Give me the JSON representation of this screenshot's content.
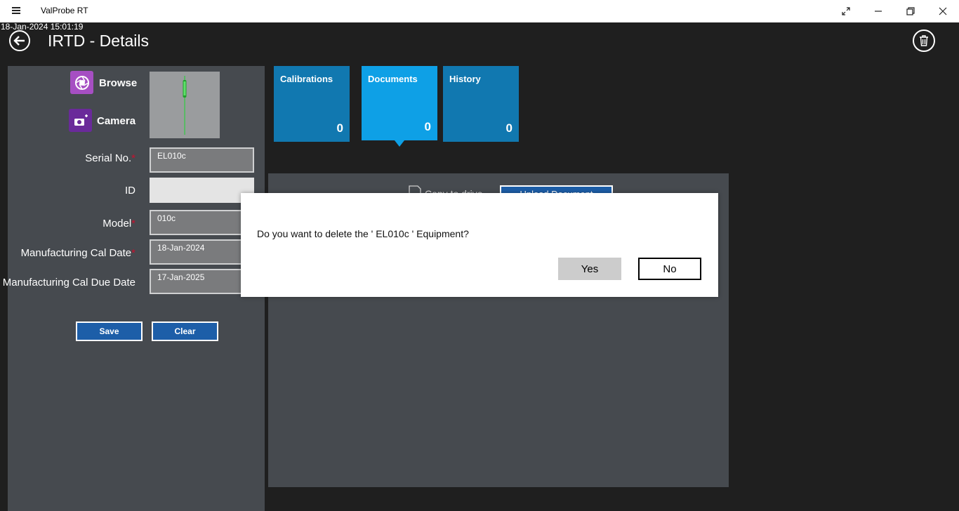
{
  "window": {
    "title": "ValProbe RT",
    "controls": [
      "expand-icon",
      "minimize-icon",
      "restore-icon",
      "close-icon"
    ]
  },
  "header": {
    "timestamp": "18-Jan-2024 15:01:19",
    "title": "IRTD - Details"
  },
  "image_source": {
    "browse_label": "Browse",
    "camera_label": "Camera"
  },
  "form": {
    "serial_label": "Serial No.",
    "serial_value": "EL010c",
    "id_label": "ID",
    "id_value": "",
    "model_label": "Model",
    "model_value": "010c",
    "mfg_cal_date_label": "Manufacturing Cal Date",
    "mfg_cal_date_value": "18-Jan-2024",
    "mfg_cal_due_label": "Manufacturing Cal Due Date",
    "mfg_cal_due_value": "17-Jan-2025",
    "required_mark": "*",
    "save_label": "Save",
    "clear_label": "Clear"
  },
  "tiles": [
    {
      "label": "Calibrations",
      "count": "0",
      "color": "#1178b0"
    },
    {
      "label": "Documents",
      "count": "0",
      "color": "#0ea0e6",
      "selected": true
    },
    {
      "label": "History",
      "count": "0",
      "color": "#1178b0"
    }
  ],
  "documents": {
    "copy_to_drive": "Copy to drive",
    "upload_label": "Upload Document"
  },
  "dialog": {
    "message": "Do you want to delete the ' EL010c ' Equipment?",
    "yes_label": "Yes",
    "no_label": "No"
  },
  "colors": {
    "panel": "#464a4f",
    "button": "#1d5ea8",
    "required": "#c8102e",
    "accent_purple": "#8a3fb0"
  }
}
